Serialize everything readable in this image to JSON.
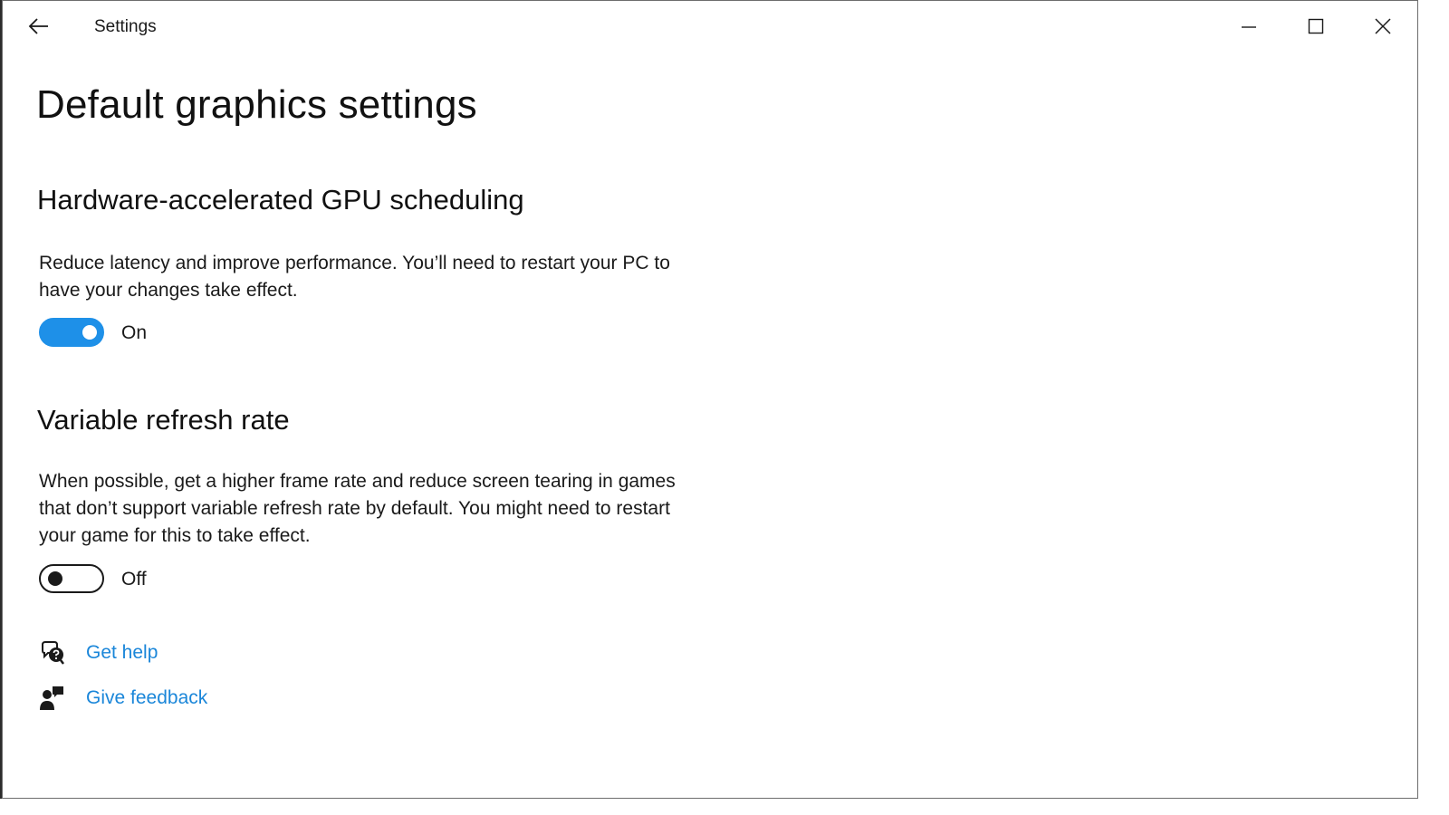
{
  "window": {
    "title": "Settings",
    "controls": {
      "minimize": "minimize-icon",
      "maximize": "maximize-icon",
      "close": "close-icon"
    },
    "back_icon": "back-arrow-icon"
  },
  "page": {
    "title": "Default graphics settings"
  },
  "gpu_scheduling": {
    "heading": "Hardware-accelerated GPU scheduling",
    "description": "Reduce latency and improve performance. You’ll need to restart your PC to have your changes take effect.",
    "toggle_state": "On",
    "enabled": true
  },
  "variable_refresh": {
    "heading": "Variable refresh rate",
    "description": "When possible, get a higher frame rate and reduce screen tearing in games that don’t support variable refresh rate by default. You might need to restart your game for this to take effect.",
    "toggle_state": "Off",
    "enabled": false
  },
  "links": {
    "help": {
      "label": "Get help",
      "icon": "help-chat-icon"
    },
    "feedback": {
      "label": "Give feedback",
      "icon": "feedback-person-icon"
    }
  },
  "colors": {
    "accent": "#1e90e8",
    "link": "#1a86d9",
    "text": "#1a1a1a",
    "background": "#ffffff"
  }
}
